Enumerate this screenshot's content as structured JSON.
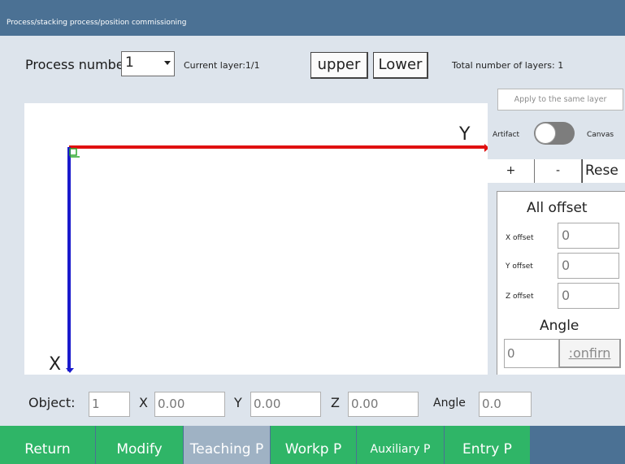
{
  "title": "Process/stacking process/position commissioning",
  "header": {
    "process_label": "Process numbe",
    "process_value": "1",
    "current_layer": "Current layer:1/1",
    "upper_label": "upper",
    "lower_label": "Lower",
    "total_layers": "Total number of layers: 1"
  },
  "side": {
    "apply_label": "Apply to the same layer",
    "artifact_label": "Artifact",
    "canvas_label": "Canvas",
    "zoom_in": "+",
    "zoom_out": "-",
    "reset": "Rese"
  },
  "offset": {
    "title": "All offset",
    "x_label": "X offset",
    "x_value": "0",
    "y_label": "Y offset",
    "y_value": "0",
    "z_label": "Z offset",
    "z_value": "0",
    "angle_title": "Angle",
    "angle_value": "0",
    "confirm_label": ":onfirn"
  },
  "canvas": {
    "y_axis_label": "Y",
    "x_axis_label": "X",
    "colors": {
      "y_axis": "#e01010",
      "x_axis": "#1a1acc",
      "origin_marker": "#2ea82e"
    }
  },
  "object_bar": {
    "object_label": "Object:",
    "object_value": "1",
    "x_label": "X",
    "x_value": "0.00",
    "y_label": "Y",
    "y_value": "0.00",
    "z_label": "Z",
    "z_value": "0.00",
    "angle_label": "Angle",
    "angle_value": "0.0"
  },
  "nav": [
    "Return",
    "Modify",
    "Teaching P",
    "Workp P",
    "Auxiliary P",
    "Entry P"
  ],
  "colors": {
    "header": "#4b7194",
    "nav_button": "#2fb567",
    "nav_active": "#9fb2c4"
  }
}
